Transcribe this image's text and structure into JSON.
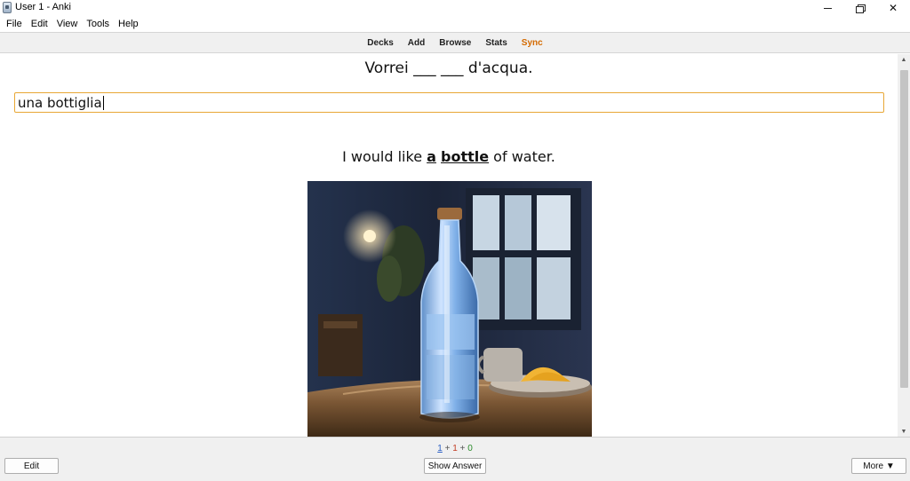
{
  "window": {
    "title": "User 1 - Anki",
    "icon": "anki-app-icon"
  },
  "menu": [
    "File",
    "Edit",
    "View",
    "Tools",
    "Help"
  ],
  "toolbar": {
    "decks": "Decks",
    "add": "Add",
    "browse": "Browse",
    "stats": "Stats",
    "sync": "Sync",
    "sync_color": "#d46a00"
  },
  "card": {
    "question": "Vorrei ___ ___ d'acqua.",
    "answer_value": "una bottiglia",
    "translation_pre": "I would like ",
    "translation_b1": "a",
    "translation_mid": " ",
    "translation_b2": "bottle",
    "translation_post": " of water.",
    "image": "glass-water-bottle-photo",
    "input_border_color": "#e8a735"
  },
  "counts": {
    "new": "1",
    "learning": "1",
    "review": "0",
    "sep": " + "
  },
  "buttons": {
    "edit": "Edit",
    "show_answer": "Show Answer",
    "more": "More ▼"
  }
}
